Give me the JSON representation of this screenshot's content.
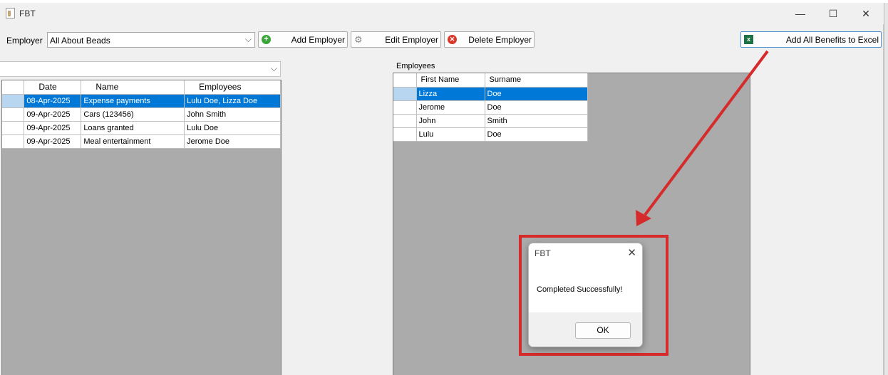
{
  "window": {
    "title": "FBT"
  },
  "window_controls": {
    "minimize": "—",
    "maximize": "☐",
    "close": "✕"
  },
  "toolbar": {
    "employer_label": "Employer",
    "employer_value": "All About Beads",
    "add_employer": "Add Employer",
    "edit_employer": "Edit Employer",
    "delete_employer": "Delete Employer",
    "add_all_benefits": "Add All Benefits to Excel"
  },
  "benefits_filter": {
    "value": ""
  },
  "benefits_table": {
    "columns": [
      "Date",
      "Name",
      "Employees"
    ],
    "rows": [
      {
        "date": "08-Apr-2025",
        "name": "Expense payments",
        "employees": "Lulu Doe, Lizza Doe",
        "selected": true
      },
      {
        "date": "09-Apr-2025",
        "name": "Cars (123456)",
        "employees": "John  Smith",
        "selected": false
      },
      {
        "date": "09-Apr-2025",
        "name": "Loans granted",
        "employees": "Lulu Doe",
        "selected": false
      },
      {
        "date": "09-Apr-2025",
        "name": "Meal entertainment",
        "employees": "Jerome Doe",
        "selected": false
      }
    ]
  },
  "employees": {
    "label": "Employees",
    "columns": [
      "First Name",
      "Surname"
    ],
    "rows": [
      {
        "first": "Lizza",
        "surname": "Doe",
        "selected": true
      },
      {
        "first": "Jerome",
        "surname": "Doe",
        "selected": false
      },
      {
        "first": "John",
        "surname": "Smith",
        "selected": false
      },
      {
        "first": "Lulu",
        "surname": "Doe",
        "selected": false
      }
    ]
  },
  "dialog": {
    "title": "FBT",
    "message": "Completed Successfully!",
    "ok_label": "OK"
  },
  "annotation": {
    "color": "#d62b2b"
  }
}
